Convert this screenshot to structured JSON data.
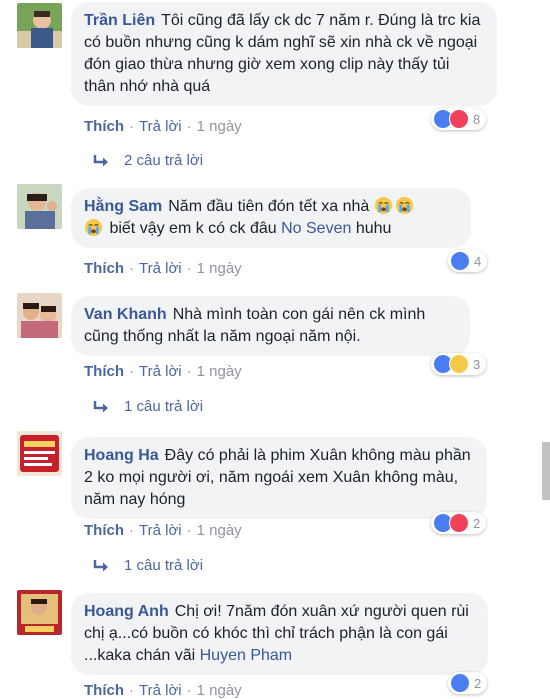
{
  "comments": [
    {
      "author": "Trần Liên",
      "text": "Tôi cũng đã lấy ck dc 7 năm r. Đúng là trc kia có buồn nhưng cũng k dám nghĩ sẽ xin nhà ck về ngoại đón giao thừa nhưng giờ xem xong clip này thấy tủi thân nhớ nhà quá",
      "like_label": "Thích",
      "reply_label": "Trả lời",
      "time": "1 ngày",
      "reactions": [
        "like",
        "love"
      ],
      "reaction_count": "8",
      "replies_label": "2 câu trả lời"
    },
    {
      "author": "Hằng Sam",
      "text_before": "Năm đầu tiên đón tết xa nhà",
      "text_after": "biết vậy em k có ck đâu",
      "tag": "No Seven",
      "text_end": "huhu",
      "emoji": "crying-face",
      "like_label": "Thích",
      "reply_label": "Trả lời",
      "time": "1 ngày",
      "reactions": [
        "like"
      ],
      "reaction_count": "4"
    },
    {
      "author": "Van Khanh",
      "text": "Nhà mình toàn con gái nên ck mình cũng thống nhất la năm ngoại năm nội.",
      "like_label": "Thích",
      "reply_label": "Trả lời",
      "time": "1 ngày",
      "reactions": [
        "like",
        "wow"
      ],
      "reaction_count": "3",
      "replies_label": "1 câu trả lời"
    },
    {
      "author": "Hoang Ha",
      "text": "Đây có phải là phim Xuân không màu phần 2 ko mọi người ơi, năm ngoái xem Xuân không màu, năm nay hóng",
      "like_label": "Thích",
      "reply_label": "Trả lời",
      "time": "1 ngày",
      "reactions": [
        "like",
        "love"
      ],
      "reaction_count": "2",
      "replies_label": "1 câu trả lời"
    },
    {
      "author": "Hoang Anh",
      "text_before": "Chị ơi! 7năm đón xuân xứ người quen rùi chị ạ...có buồn có khóc thì chỉ trách phận là con gái ...kaka chán vãi",
      "tag": "Huyen Pham",
      "like_label": "Thích",
      "reply_label": "Trả lời",
      "time": "1 ngày",
      "reactions": [
        "like"
      ],
      "reaction_count": "2"
    }
  ],
  "colors": {
    "name_link": "#385898",
    "bubble_bg": "#f2f3f5",
    "meta_gray": "#90949c",
    "like_blue": "#4a7ef0",
    "love_red": "#f0405a",
    "wow_yellow": "#f7c94a"
  }
}
